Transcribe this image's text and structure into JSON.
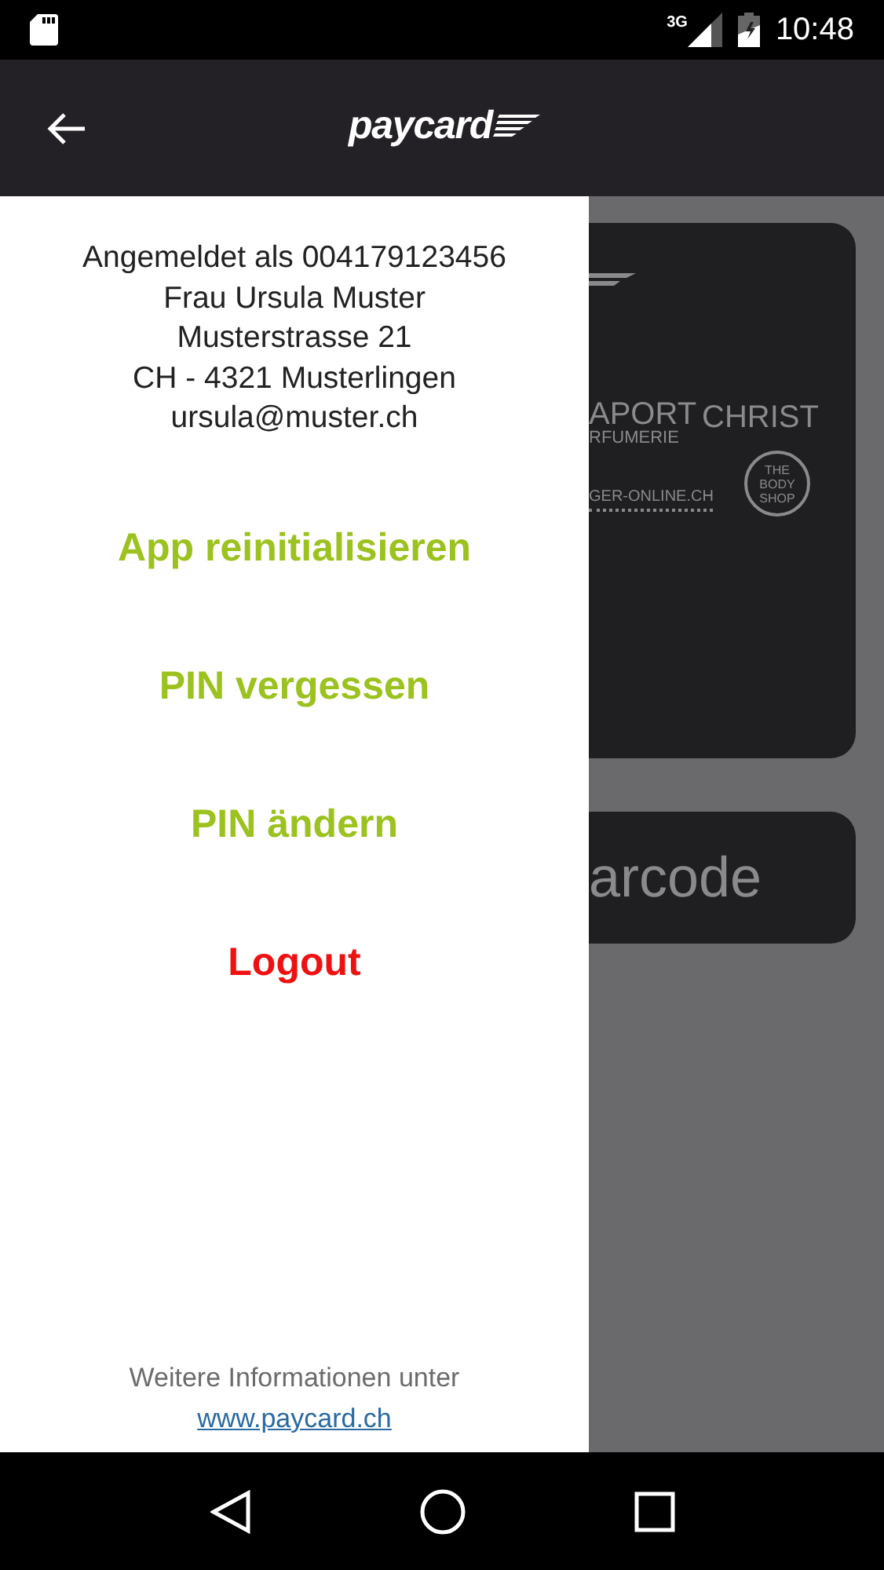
{
  "status_bar": {
    "network": "3G",
    "time": "10:48"
  },
  "app_bar": {
    "logo": "paycard"
  },
  "card": {
    "logos": [
      {
        "kind": "top",
        "text": "APORT"
      },
      {
        "kind": "sub",
        "text": "RFUMERIE"
      },
      {
        "kind": "top",
        "text": "CHRIST"
      },
      {
        "kind": "url",
        "text": "GER-ONLINE.CH"
      },
      {
        "kind": "round",
        "text": "THE BODY SHOP"
      }
    ]
  },
  "barcode_button": {
    "label": "arcode"
  },
  "drawer": {
    "account": [
      "Angemeldet als 004179123456",
      "Frau Ursula Muster",
      "Musterstrasse 21",
      "CH - 4321 Musterlingen",
      "ursula@muster.ch"
    ],
    "menu": [
      {
        "label": "App reinitialisieren",
        "color": "#9bc21f"
      },
      {
        "label": "PIN vergessen",
        "color": "#9bc21f"
      },
      {
        "label": "PIN ändern",
        "color": "#9bc21f"
      },
      {
        "label": "Logout",
        "color": "#ee1111"
      }
    ],
    "footer": {
      "text": "Weitere Informationen unter",
      "link": "www.paycard.ch"
    }
  }
}
